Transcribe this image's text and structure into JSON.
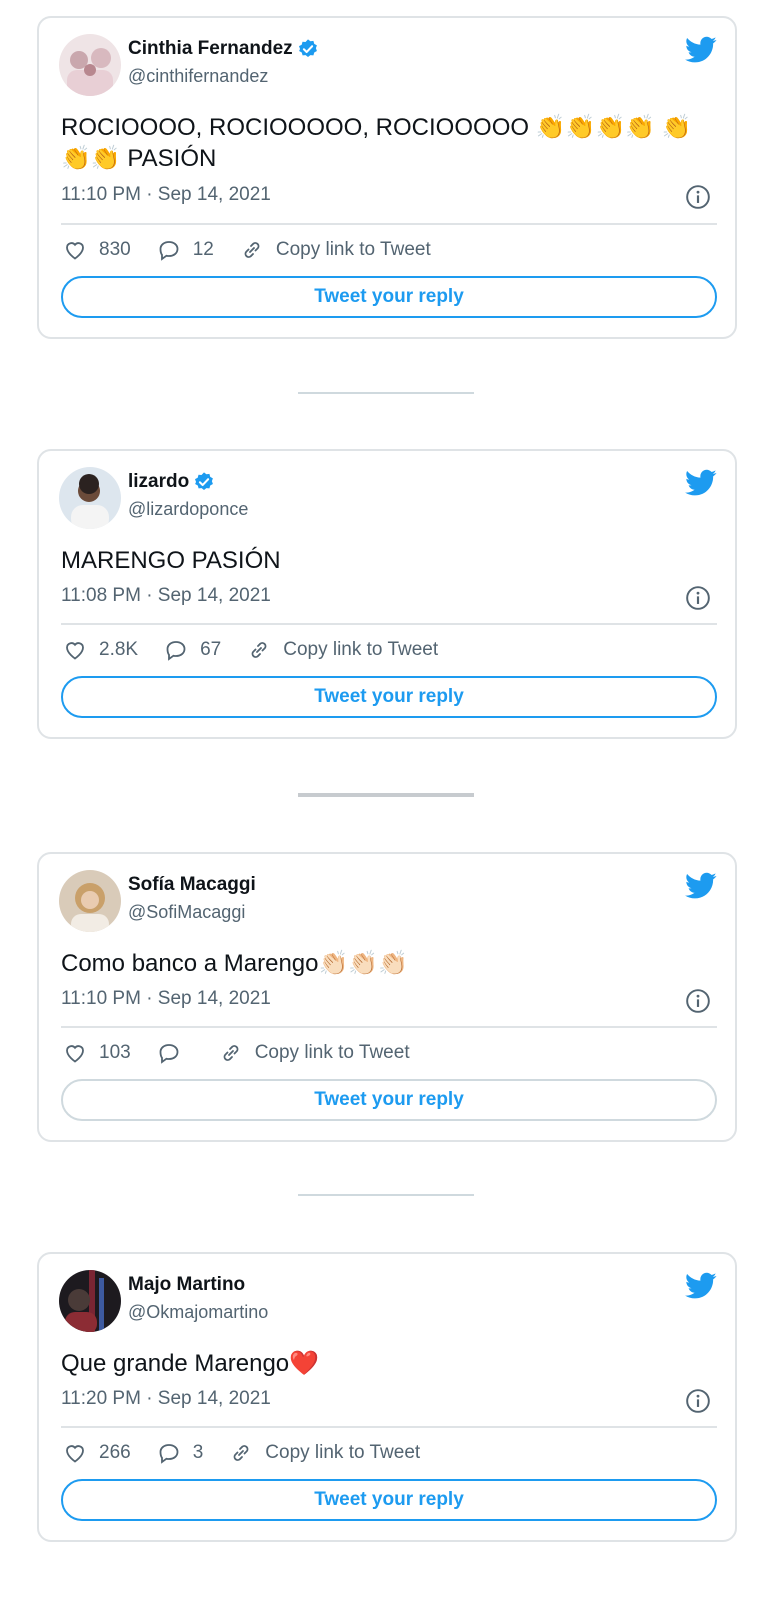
{
  "tweets": [
    {
      "display_name": "Cinthia Fernandez",
      "verified": true,
      "handle": "@cinthifernandez",
      "text": "ROCIOOOO, ROCIOOOOO, ROCIOOOOO 👏👏👏👏 👏👏👏 PASIÓN",
      "timestamp": "11:10 PM · Sep 14, 2021",
      "likes": "830",
      "replies": "12",
      "copy_link_label": "Copy link to Tweet",
      "reply_button_label": "Tweet your reply"
    },
    {
      "display_name": "lizardo",
      "verified": true,
      "handle": "@lizardoponce",
      "text": "MARENGO PASIÓN",
      "timestamp": "11:08 PM · Sep 14, 2021",
      "likes": "2.8K",
      "replies": "67",
      "copy_link_label": "Copy link to Tweet",
      "reply_button_label": "Tweet your reply"
    },
    {
      "display_name": "Sofía Macaggi",
      "verified": false,
      "handle": "@SofiMacaggi",
      "text": "Como banco a Marengo👏🏻👏🏻👏🏻",
      "timestamp": "11:10 PM · Sep 14, 2021",
      "likes": "103",
      "replies": "",
      "copy_link_label": "Copy link to Tweet",
      "reply_button_label": "Tweet your reply"
    },
    {
      "display_name": "Majo Martino",
      "verified": false,
      "handle": "@Okmajomartino",
      "text": "Que grande Marengo❤️",
      "timestamp": "11:20 PM · Sep 14, 2021",
      "likes": "266",
      "replies": "3",
      "copy_link_label": "Copy link to Tweet",
      "reply_button_label": "Tweet your reply"
    }
  ],
  "icons": {
    "logo": "twitter-bird-icon",
    "verified": "verified-badge-icon",
    "info": "info-icon",
    "like": "heart-icon",
    "reply": "reply-bubble-icon",
    "link": "link-icon"
  },
  "colors": {
    "accent": "#1d9bf0",
    "border": "#dfe3e6",
    "secondary_text": "#536471",
    "primary_text": "#0f1419"
  }
}
